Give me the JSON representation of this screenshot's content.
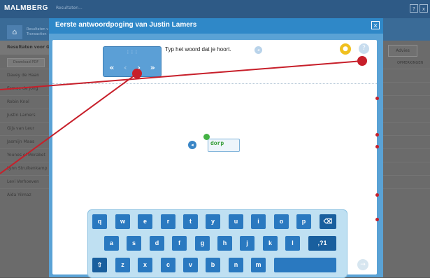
{
  "app": {
    "brand": "MALMBERG",
    "subtitle": "Resultaten...",
    "top_icons": [
      "?",
      "x"
    ]
  },
  "breadcrumb": {
    "line1": "Resultaten v",
    "line2": "Transaction"
  },
  "left_panel": {
    "title": "Resultaten voor G",
    "pdf_button": "Download PDF",
    "names": [
      "Davey de Haan",
      "Esmee de Jong",
      "Robin Knol",
      "Justin Lamers",
      "Gijs van Leur",
      "Jasmijn Maas",
      "Younes el Morabet",
      "Lynn Struikenkamp",
      "Levi Verhoeven",
      "Aida Yilmaz"
    ]
  },
  "right_panel": {
    "advies_button": "Advies",
    "opmerkingen_header": "OPMERKINGEN"
  },
  "modal": {
    "title": "Eerste antwoordpoging van Justin Lamers",
    "close_label": "×",
    "instruction": "Typ het woord dat je hoort.",
    "answer": "dorp",
    "nav": {
      "first": "«",
      "prev": "‹",
      "next": "›",
      "last": "»",
      "handle": "⋮⋮⋮"
    }
  },
  "keyboard": {
    "row1": [
      "q",
      "w",
      "e",
      "r",
      "t",
      "y",
      "u",
      "i",
      "o",
      "p",
      "⌫"
    ],
    "row2": [
      "a",
      "s",
      "d",
      "f",
      "g",
      "h",
      "j",
      "k",
      "l",
      ",?1"
    ],
    "row3": [
      "⇧",
      "z",
      "x",
      "c",
      "v",
      "b",
      "n",
      "m"
    ],
    "space": "",
    "go": "→"
  },
  "icons": {
    "home": "home-icon",
    "speaker": "speaker-icon",
    "hint": "lightbulb-icon",
    "help": "help-icon",
    "smiley": "smiley-icon"
  },
  "colors": {
    "accent": "#2f88c8",
    "annotation": "#c71f2a",
    "answer_green": "#2f9a2f"
  }
}
